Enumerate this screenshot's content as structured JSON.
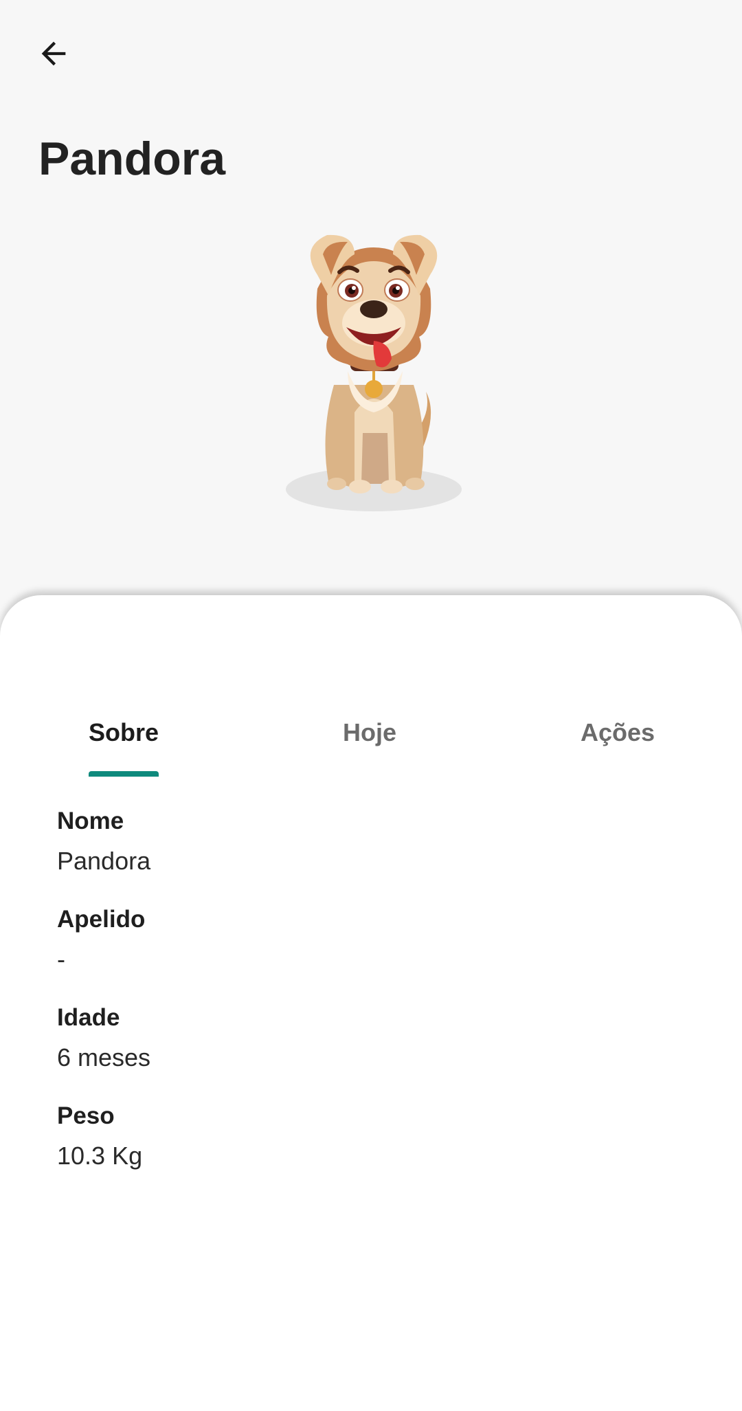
{
  "header": {
    "back_icon": "arrow-left-icon",
    "title": "Pandora"
  },
  "pet": {
    "image": "cartoon-dog-illustration"
  },
  "tabs": [
    {
      "label": "Sobre",
      "active": true
    },
    {
      "label": "Hoje",
      "active": false
    },
    {
      "label": "Ações",
      "active": false
    }
  ],
  "accent_color": "#0f8a7d",
  "details": {
    "nome": {
      "label": "Nome",
      "value": "Pandora"
    },
    "apelido": {
      "label": "Apelido",
      "value": "-"
    },
    "idade": {
      "label": "Idade",
      "value": "6 meses"
    },
    "peso": {
      "label": "Peso",
      "value": "10.3 Kg"
    }
  }
}
